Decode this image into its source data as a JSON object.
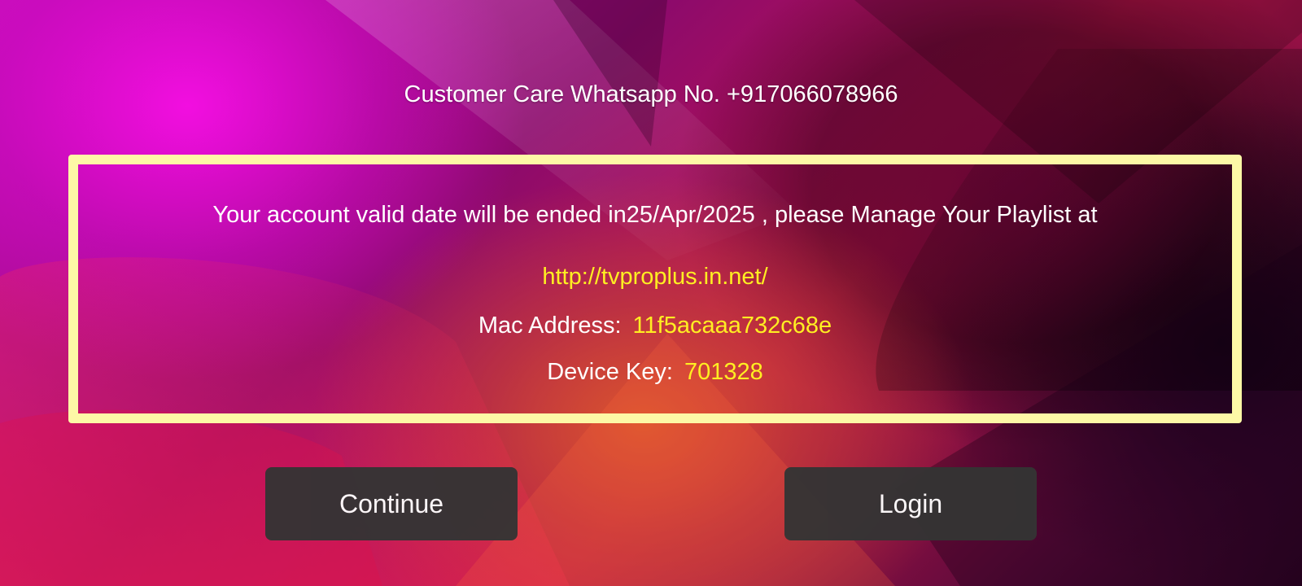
{
  "header": {
    "customer_care": "Customer Care Whatsapp No. +917066078966"
  },
  "info": {
    "message": "Your account valid date will be ended in25/Apr/2025 , please Manage Your Playlist at",
    "url": "http://tvproplus.in.net/",
    "mac_label": "Mac Address:",
    "mac_value": "11f5acaaa732c68e",
    "key_label": "Device Key:",
    "key_value": "701328"
  },
  "buttons": {
    "continue_label": "Continue",
    "login_label": "Login"
  },
  "colors": {
    "box_border": "#fdf8a6",
    "highlight_text": "#ffee22",
    "button_bg": "#343434"
  }
}
